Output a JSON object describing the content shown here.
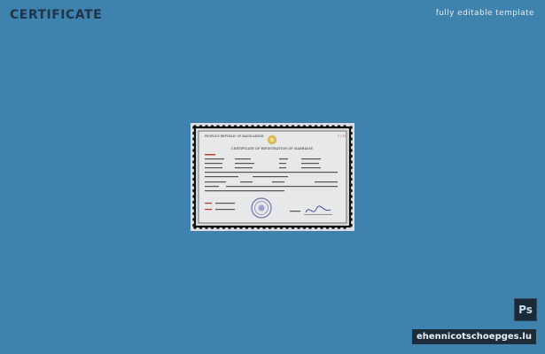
{
  "header": {
    "title": "CERTIFICATE",
    "tagline": "fully editable template"
  },
  "certificate": {
    "republic_line": "PEOPLE'S REPUBLIC OF BANGLADESH",
    "number": "1 / 11",
    "title": "CERTIFICATE OF REGISTRATION OF MARRIAGE"
  },
  "badges": {
    "app_badge": "Ps",
    "watermark_logo_text": "ehennicotschoepges.lu"
  },
  "colors": {
    "background": "#3f82ad",
    "title": "#1f3447",
    "accent_red": "#b13a2d",
    "seal": "#5b5fa5",
    "emblem": "#d7b23a"
  }
}
